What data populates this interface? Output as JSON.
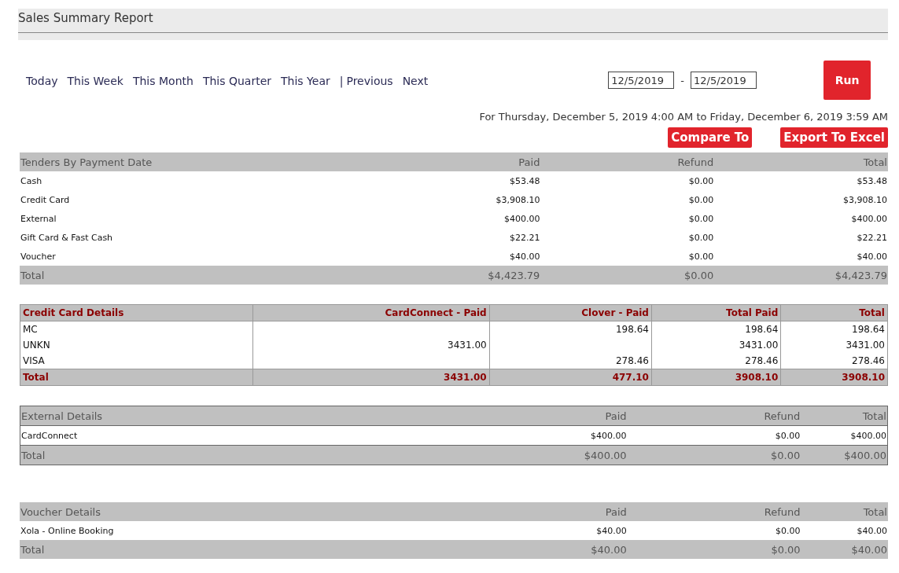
{
  "title": "Sales Summary Report",
  "nav": [
    {
      "label": "Today",
      "kind": "link"
    },
    {
      "label": "This Week",
      "kind": "link"
    },
    {
      "label": "This Month",
      "kind": "link"
    },
    {
      "label": "This Quarter",
      "kind": "link"
    },
    {
      "label": "This Year",
      "kind": "link"
    },
    {
      "label": "|",
      "kind": "separator"
    },
    {
      "label": "Previous",
      "kind": "link"
    },
    {
      "label": "Next",
      "kind": "link"
    }
  ],
  "date_from": "12/5/2019",
  "date_separator": "-",
  "date_to": "12/5/2019",
  "run_button": "Run",
  "range_text": "For Thursday, December 5, 2019 4:00 AM to Friday, December 6, 2019 3:59 AM",
  "actions": [
    "Compare To",
    "Export To Excel"
  ],
  "tables": [
    {
      "kind": "plain",
      "columns": [
        "Tenders By Payment Date",
        "Paid",
        "Refund",
        "Total"
      ],
      "rows": [
        [
          "Cash",
          "$53.48",
          "$0.00",
          "$53.48"
        ],
        [
          "Credit Card",
          "$3,908.10",
          "$0.00",
          "$3,908.10"
        ],
        [
          "External",
          "$400.00",
          "$0.00",
          "$400.00"
        ],
        [
          "Gift Card & Fast Cash",
          "$22.21",
          "$0.00",
          "$22.21"
        ],
        [
          "Voucher",
          "$40.00",
          "$0.00",
          "$40.00"
        ]
      ],
      "total": [
        "Total",
        "$4,423.79",
        "$0.00",
        "$4,423.79"
      ]
    },
    {
      "kind": "grid",
      "columns": [
        "Credit Card Details",
        "CardConnect - Paid",
        "Clover - Paid",
        "Total Paid",
        "Total"
      ],
      "rows": [
        [
          "MC",
          "",
          "198.64",
          "198.64",
          "198.64"
        ],
        [
          "UNKN",
          "3431.00",
          "",
          "3431.00",
          "3431.00"
        ],
        [
          "VISA",
          "",
          "278.46",
          "278.46",
          "278.46"
        ]
      ],
      "total": [
        "Total",
        "3431.00",
        "477.10",
        "3908.10",
        "3908.10"
      ]
    },
    {
      "kind": "boxed",
      "columns": [
        "External Details",
        "Paid",
        "Refund",
        "Total"
      ],
      "rows": [
        [
          "CardConnect",
          "$400.00",
          "$0.00",
          "$400.00"
        ]
      ],
      "total": [
        "Total",
        "$400.00",
        "$0.00",
        "$400.00"
      ]
    },
    {
      "kind": "plain",
      "columns": [
        "Voucher Details",
        "Paid",
        "Refund",
        "Total"
      ],
      "rows": [
        [
          "Xola - Online Booking",
          "$40.00",
          "$0.00",
          "$40.00"
        ]
      ],
      "total": [
        "Total",
        "$40.00",
        "$0.00",
        "$40.00"
      ]
    }
  ]
}
